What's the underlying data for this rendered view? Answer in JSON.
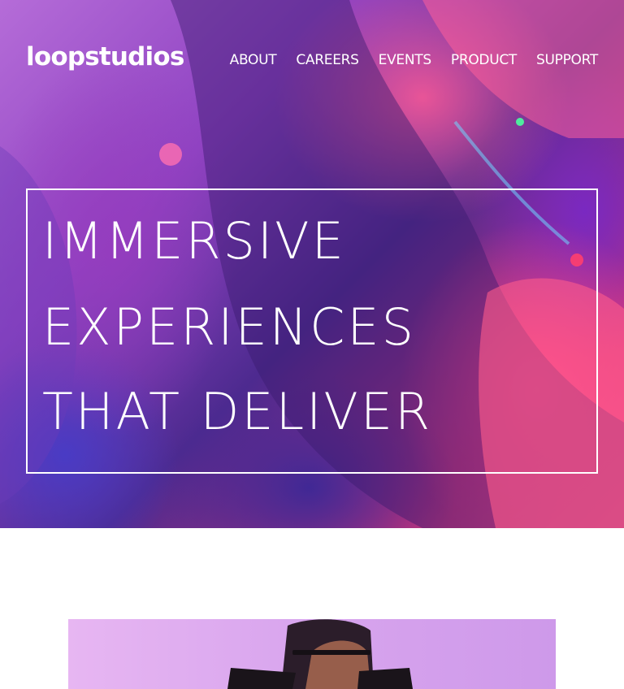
{
  "brand": {
    "logo_text": "loopstudios"
  },
  "nav": {
    "items": [
      "ABOUT",
      "CAREERS",
      "EVENTS",
      "PRODUCT",
      "SUPPORT"
    ]
  },
  "hero": {
    "headline_lines": [
      "IMMERSIVE",
      "EXPERIENCES",
      "THAT DELIVER"
    ]
  },
  "colors": {
    "text": "#ffffff",
    "hero_accent_pink": "#ff4e86",
    "hero_accent_purple": "#8f43c2",
    "promo_background": "#e0aef0"
  },
  "icons": {
    "logo": "loopstudios-wordmark"
  }
}
